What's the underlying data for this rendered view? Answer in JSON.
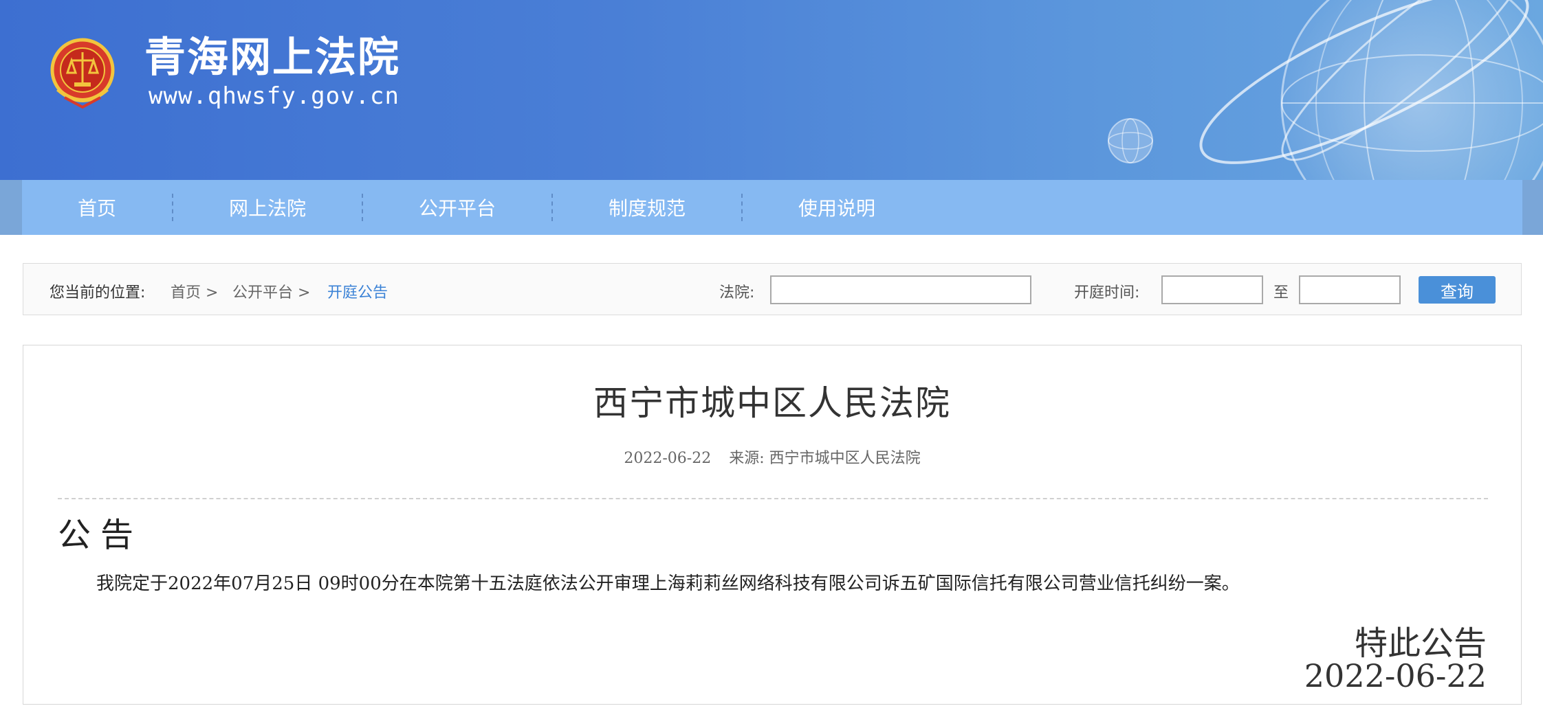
{
  "header": {
    "site_title": "青海网上法院",
    "site_url": "www.qhwsfy.gov.cn"
  },
  "nav": {
    "items": [
      {
        "label": "首页"
      },
      {
        "label": "网上法院"
      },
      {
        "label": "公开平台"
      },
      {
        "label": "制度规范"
      },
      {
        "label": "使用说明"
      }
    ]
  },
  "breadcrumb": {
    "prefix": "您当前的位置:",
    "items": [
      "首页 >",
      "公开平台 >",
      "开庭公告"
    ]
  },
  "search": {
    "court_label": "法院:",
    "court_value": "",
    "time_label": "开庭时间:",
    "date_from_value": "",
    "to_label": "至",
    "date_to_value": "",
    "query_label": "查询"
  },
  "article": {
    "title": "西宁市城中区人民法院",
    "date": "2022-06-22",
    "source": "来源: 西宁市城中区人民法院",
    "heading": "公告",
    "body": "我院定于2022年07月25日 09时00分在本院第十五法庭依法公开审理上海莉莉丝网络科技有限公司诉五矿国际信托有限公司营业信托纠纷一案。",
    "signoff": "特此公告",
    "signoff_date": "2022-06-22"
  },
  "colors": {
    "header_blue": "#3d6fd1",
    "nav_blue": "#86b9f2",
    "button_blue": "#4a90d9",
    "link_blue": "#3b82d6"
  }
}
